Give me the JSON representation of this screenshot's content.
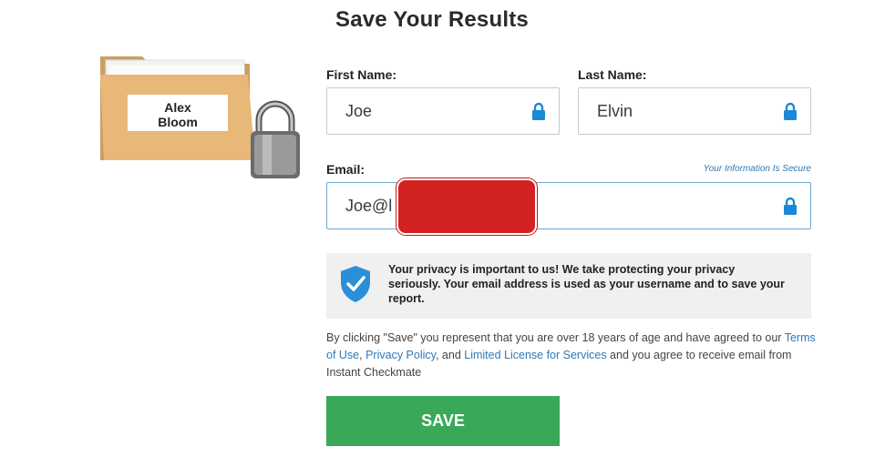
{
  "page": {
    "title": "Save Your Results"
  },
  "folder": {
    "name_line1": "Alex",
    "name_line2": "Bloom"
  },
  "form": {
    "first_name_label": "First Name:",
    "first_name_value": "Joe",
    "last_name_label": "Last Name:",
    "last_name_value": "Elvin",
    "email_label": "Email:",
    "email_value": "Joe@l",
    "secure_note": "Your Information Is Secure"
  },
  "privacy": {
    "text": "Your privacy is important to us! We take protecting your privacy seriously. Your email address is used as your username and to save your report."
  },
  "consent": {
    "part1": "By clicking \"Save\" you represent that you are over 18 years of age and have agreed to our ",
    "terms": "Terms of Use",
    "sep1": ", ",
    "privacy_policy": "Privacy Policy",
    "sep2": ", and ",
    "license": "Limited License for Services",
    "part2": " and you agree to receive email from Instant Checkmate"
  },
  "actions": {
    "save_label": "SAVE"
  },
  "colors": {
    "accent_green": "#3aa859",
    "link_blue": "#2f78b5",
    "lock_blue": "#1a8ad8",
    "redaction": "#d32222"
  }
}
